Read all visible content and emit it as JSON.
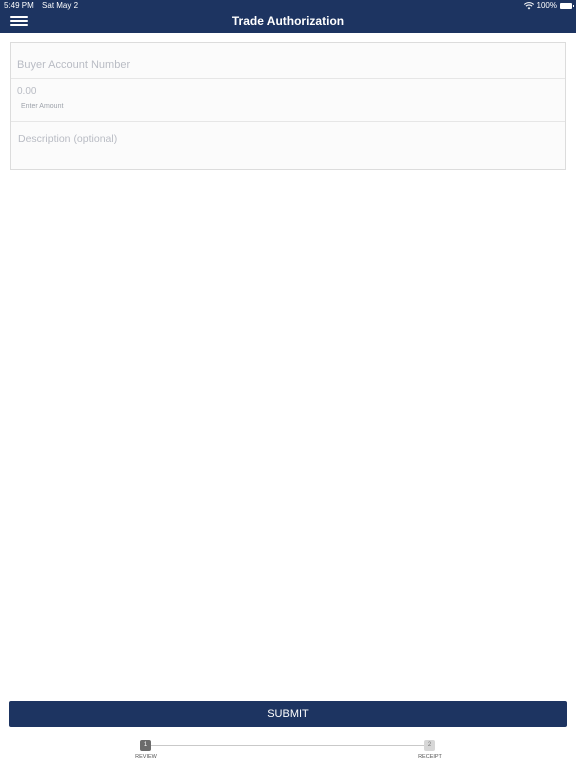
{
  "status_bar": {
    "time": "5:49 PM",
    "date": "Sat May 2",
    "battery": "100%",
    "wifi_icon": "wifi-icon",
    "battery_icon": "battery-icon"
  },
  "header": {
    "title": "Trade Authorization",
    "menu_icon": "hamburger-menu-icon",
    "background_color": "#1d3461"
  },
  "form": {
    "account_placeholder": "Buyer Account Number",
    "amount_value": "0.00",
    "amount_hint": "Enter Amount",
    "description_placeholder": "Description (optional)"
  },
  "submit_label": "SUBMIT",
  "stepper": {
    "steps": [
      {
        "number": "1",
        "label": "REVIEW"
      },
      {
        "number": "2",
        "label": "RECEIPT"
      }
    ]
  }
}
